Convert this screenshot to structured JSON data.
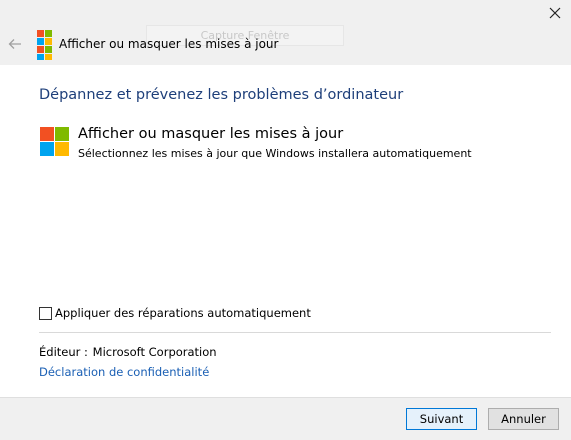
{
  "window": {
    "title": "Afficher ou masquer les mises à jour",
    "ghost_label": "Capture Fenêtre"
  },
  "content": {
    "heading": "Dépannez et prévenez les problèmes d’ordinateur",
    "tool_title": "Afficher ou masquer les mises à jour",
    "tool_description": "Sélectionnez les mises à jour que Windows installera automatiquement",
    "auto_repair_label": "Appliquer des réparations automatiquement",
    "auto_repair_checked": false,
    "publisher_label": "Éditeur :",
    "publisher_value": "Microsoft Corporation",
    "privacy_link": "Déclaration de confidentialité"
  },
  "footer": {
    "next_label": "Suivant",
    "cancel_label": "Annuler"
  },
  "colors": {
    "heading": "#1e3f7a",
    "link": "#1a5fb4",
    "logo_red": "#f25022",
    "logo_green": "#7fba00",
    "logo_blue": "#00a4ef",
    "logo_yellow": "#ffb900"
  }
}
